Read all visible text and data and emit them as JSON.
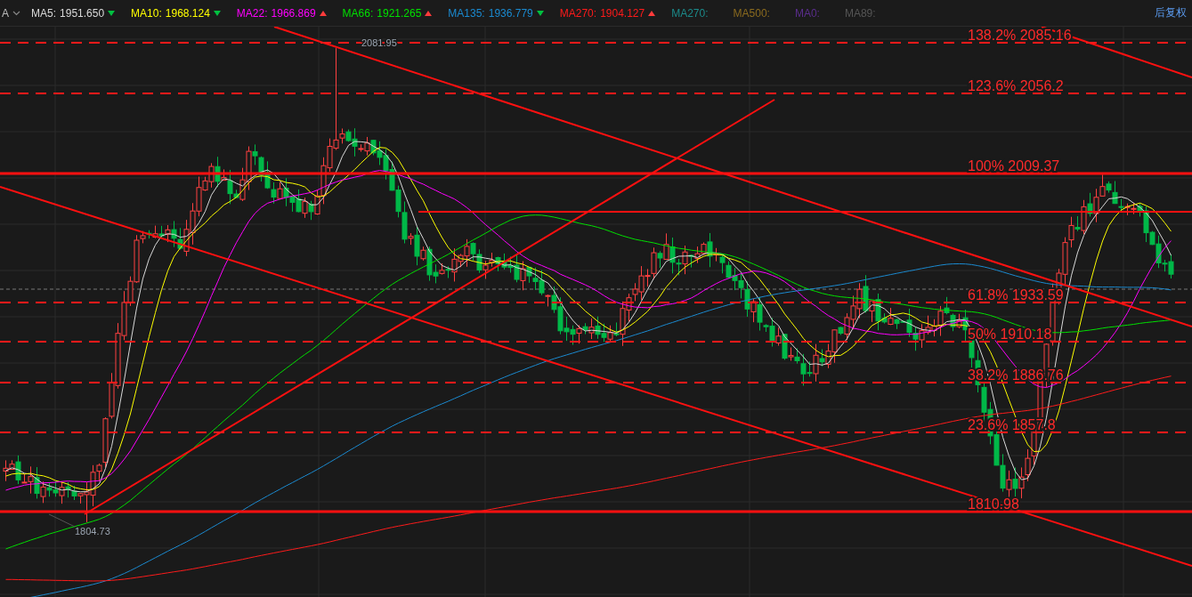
{
  "indicator_selector": {
    "label": "A"
  },
  "moving_averages": [
    {
      "name": "MA5:",
      "value": "1951.650",
      "rising": false,
      "color": "#d9d9d9"
    },
    {
      "name": "MA10:",
      "value": "1968.124",
      "rising": false,
      "color": "#ffff00"
    },
    {
      "name": "MA22:",
      "value": "1966.869",
      "rising": true,
      "color": "#ff00ff"
    },
    {
      "name": "MA66:",
      "value": "1921.265",
      "rising": true,
      "color": "#00e000"
    },
    {
      "name": "MA135:",
      "value": "1936.779",
      "rising": false,
      "color": "#1a8ad0"
    },
    {
      "name": "MA270:",
      "value": "1904.127",
      "rising": true,
      "color": "#ff1a1a"
    },
    {
      "name": "MA270:",
      "color": "#1b8a8a"
    },
    {
      "name": "MA500:",
      "color": "#8a6a1e"
    },
    {
      "name": "MA0:",
      "color": "#5a2d8c"
    },
    {
      "name": "MA89:",
      "color": "#555555"
    }
  ],
  "adjust_button": {
    "label": "后复权"
  },
  "chart": {
    "price_labels": [
      {
        "kind": "high",
        "text": "2081.95"
      },
      {
        "kind": "low",
        "text": "1804.73"
      }
    ],
    "fibonacci_levels": [
      {
        "label": "138.2% 2085.16",
        "kind": "dashed"
      },
      {
        "label": "123.6% 2056.2",
        "kind": "dashed"
      },
      {
        "label": "100% 2009.37",
        "kind": "solid"
      },
      {
        "label": "61.8% 1933.59",
        "kind": "dashed"
      },
      {
        "label": "50% 1910.18",
        "kind": "dashed"
      },
      {
        "label": "38.2% 1886.76",
        "kind": "dashed"
      },
      {
        "label": "23.6% 1857.8",
        "kind": "dashed"
      },
      {
        "label": "1810.98",
        "kind": "solid"
      }
    ]
  }
}
